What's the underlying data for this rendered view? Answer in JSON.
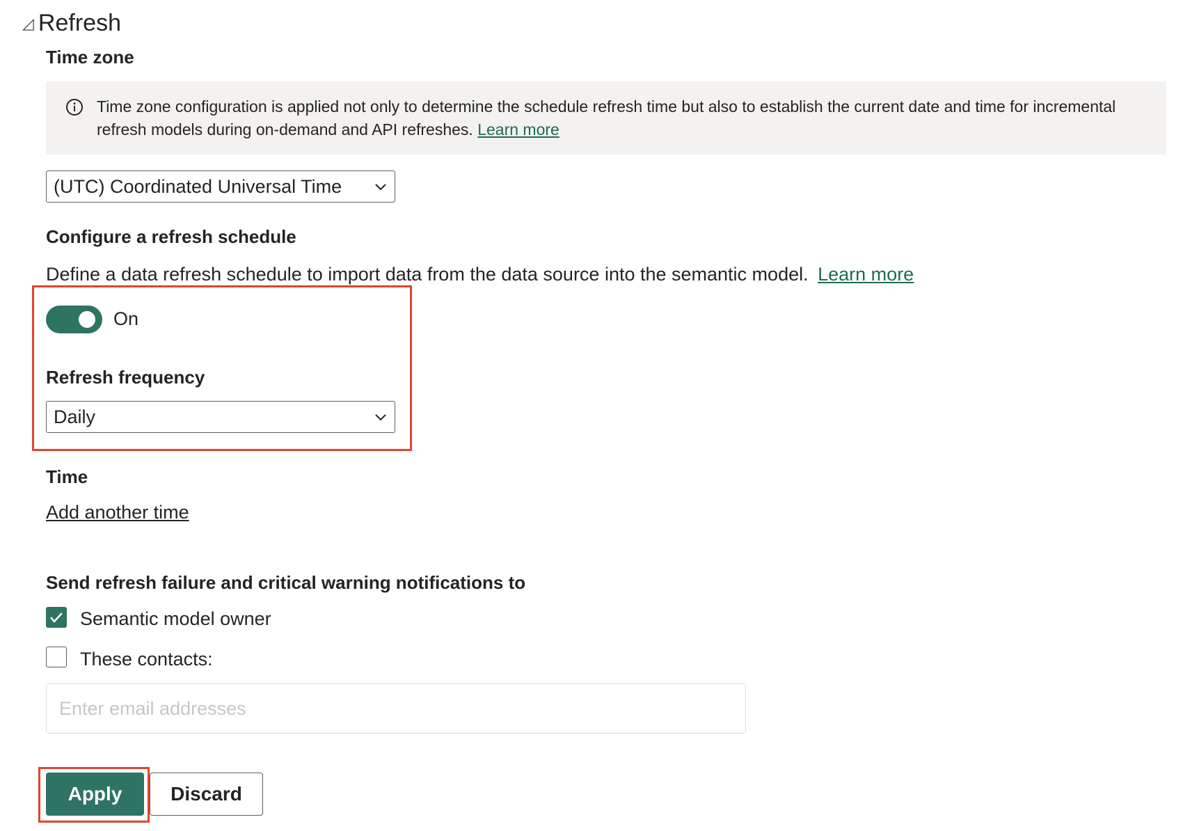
{
  "section": {
    "caret": "◿",
    "title": "Refresh"
  },
  "time_zone": {
    "label": "Time zone",
    "info_text": "Time zone configuration is applied not only to determine the schedule refresh time but also to establish the current date and time for incremental refresh models during on-demand and API refreshes.",
    "info_link": "Learn more",
    "selected": "(UTC) Coordinated Universal Time"
  },
  "schedule": {
    "heading": "Configure a refresh schedule",
    "description": "Define a data refresh schedule to import data from the data source into the semantic model.",
    "learn_more": "Learn more",
    "toggle_state": "On",
    "frequency_label": "Refresh frequency",
    "frequency_selected": "Daily"
  },
  "time": {
    "label": "Time",
    "add_link": "Add another time"
  },
  "notifications": {
    "heading": "Send refresh failure and critical warning notifications to",
    "owner_label": "Semantic model owner",
    "owner_checked": true,
    "contacts_label": "These contacts:",
    "contacts_checked": false,
    "email_placeholder": "Enter email addresses"
  },
  "actions": {
    "apply": "Apply",
    "discard": "Discard"
  },
  "colors": {
    "accent": "#2e7462",
    "highlight": "#e2442f",
    "link": "#1f6b55",
    "info_bg": "#f3f2f1"
  },
  "icons": [
    "caret-icon",
    "info-icon",
    "chevron-down-icon",
    "checkmark-icon"
  ]
}
